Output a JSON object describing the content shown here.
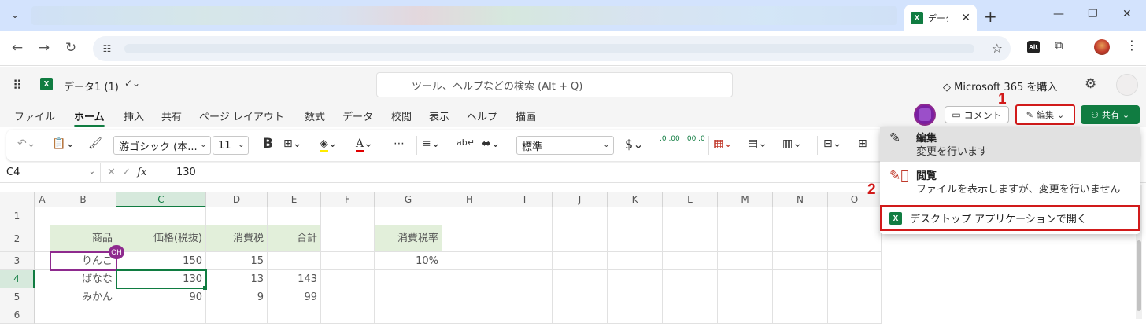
{
  "browser": {
    "tab_title": "データ",
    "omnibox_url": ""
  },
  "excel": {
    "app_icon": "X",
    "doc_name": "データ1 (1)",
    "search_placeholder": "ツール、ヘルプなどの検索 (Alt + Q)",
    "buy_label": "Microsoft 365 を購入",
    "ribbon_tabs": [
      "ファイル",
      "ホーム",
      "挿入",
      "共有",
      "ページ レイアウト",
      "数式",
      "データ",
      "校閲",
      "表示",
      "ヘルプ",
      "描画"
    ],
    "active_tab": "ホーム",
    "comment_label": "コメント",
    "edit_label": "編集",
    "share_label": "共有",
    "callout_1": "1",
    "callout_2": "2",
    "font_name": "游ゴシック (本...",
    "font_size": "11",
    "number_format": "標準",
    "bold_label": "B",
    "currency_label": "$",
    "inc_decimal": ".0 .00",
    "dec_decimal": ".00 .0"
  },
  "formula_bar": {
    "name_box": "C4",
    "fx_label": "fx",
    "value": "130"
  },
  "grid": {
    "columns": [
      "A",
      "B",
      "C",
      "D",
      "E",
      "F",
      "G",
      "H",
      "I",
      "J",
      "K",
      "L",
      "M",
      "N",
      "O"
    ],
    "rows": [
      "1",
      "2",
      "3",
      "4",
      "5",
      "6"
    ],
    "cells": {
      "B2": "商品",
      "C2": "価格(税抜)",
      "D2": "消費税",
      "E2": "合計",
      "G2": "消費税率",
      "B3": "りんご",
      "C3": "150",
      "D3": "15",
      "G3": "10%",
      "B4": "ばなな",
      "C4": "130",
      "D4": "13",
      "E4": "143",
      "B5": "みかん",
      "C5": "90",
      "D5": "9",
      "E5": "99"
    },
    "presence_initials": "OH"
  },
  "mode_menu": {
    "items": [
      {
        "title": "編集",
        "desc": "変更を行います",
        "icon": "pencil-icon"
      },
      {
        "title": "閲覧",
        "desc": "ファイルを表示しますが、変更を行いません",
        "icon": "no-edit-icon"
      }
    ],
    "open_desktop_label": "デスクトップ アプリケーションで開く"
  },
  "colors": {
    "excel_green": "#107c41",
    "highlight_red": "#d11a1a",
    "presence_purple": "#8e2a8e",
    "header_fill": "#e2efda"
  }
}
